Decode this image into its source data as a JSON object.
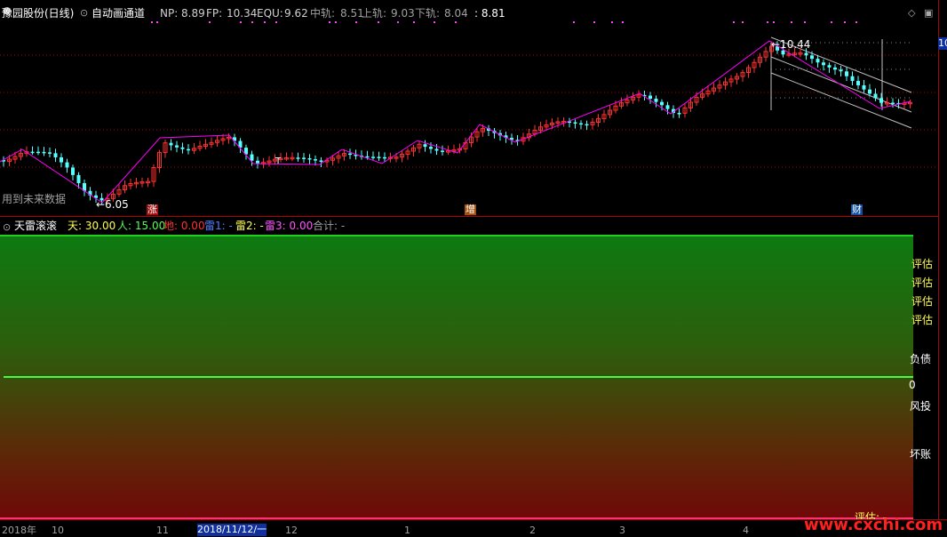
{
  "header": {
    "stock_name": "豫园股份(日线)",
    "indicator_name": "自动画通道",
    "np_label": "NP:",
    "np_value": "8.89",
    "fp_label": "FP:",
    "fp_value": "10.34",
    "equ_label": "EQU:",
    "equ_value": "9.62",
    "mid_label": "中轨:",
    "mid_value": "8.51",
    "up_label": "上轨:",
    "up_value": "9.03",
    "down_label": "下轨:",
    "down_value": "8.04",
    "extra_value": ": 8.81"
  },
  "main_chart": {
    "low_label": "←6.05",
    "high_label": "←10.44",
    "future_data_note": "用到未来数据",
    "t_marker": "T",
    "markers": [
      "涨",
      "增",
      "财"
    ],
    "right_price": "10"
  },
  "sub_header": {
    "name": "天雷滚滚",
    "tian": "天: 30.00",
    "ren": "人: 15.00",
    "di": "地: 0.00",
    "lei1": "雷1: -",
    "lei2": "雷2: -",
    "lei3": "雷3: 0.00",
    "heji": "合计: -"
  },
  "sub_labels": {
    "pg1": "评估",
    "pg2": "评估",
    "pg3": "评估",
    "pg4": "评估",
    "fuzhai": "负债",
    "zero": "0",
    "fengtou": "风投",
    "huaizhang": "坏账",
    "bottom_pg": "评估: -"
  },
  "time_axis": {
    "labels": [
      "2018年",
      "10",
      "11",
      "2018/11/12/一",
      "12",
      "1",
      "2",
      "3",
      "4"
    ]
  },
  "watermark": "www.cxchi.com",
  "colors": {
    "up": "#ff3030",
    "down": "#54ffff",
    "zigzag": "#ff00ff",
    "channel": "#c0c0c0",
    "yellow": "#ffff54",
    "green": "#54ff54"
  }
}
